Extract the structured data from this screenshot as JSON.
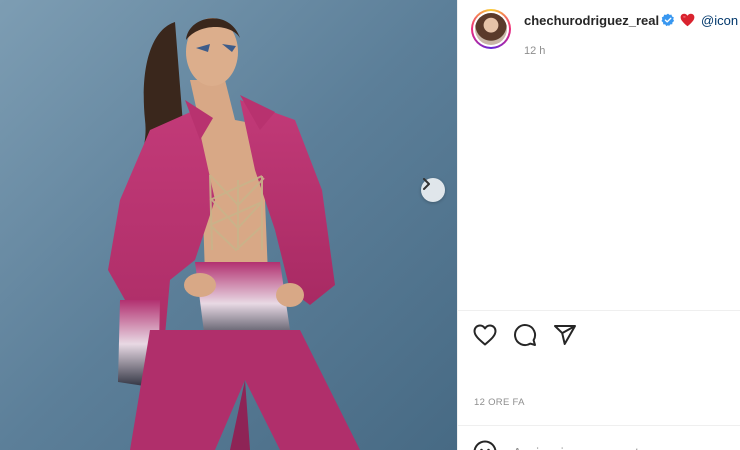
{
  "post": {
    "photo_alt": "",
    "next_icon": "chevron-right-icon"
  },
  "header": {
    "username": "chechurodriguez_real",
    "verified_icon": "verified-badge-icon",
    "emoji_icon": "red-heart-emoji",
    "mention": "@icon",
    "time_ago": "12 h"
  },
  "actions": {
    "like_icon": "heart-icon",
    "comment_icon": "comment-icon",
    "share_icon": "share-icon"
  },
  "meta": {
    "date": "12 ORE FA"
  },
  "comment": {
    "placeholder": "Aggiungi un commento..."
  },
  "colors": {
    "brand_ring": [
      "#f9ce34",
      "#ee2a7b",
      "#6228d7"
    ],
    "verified": "#3897f0",
    "mention": "#00376b",
    "muted": "#8e8e8e"
  }
}
